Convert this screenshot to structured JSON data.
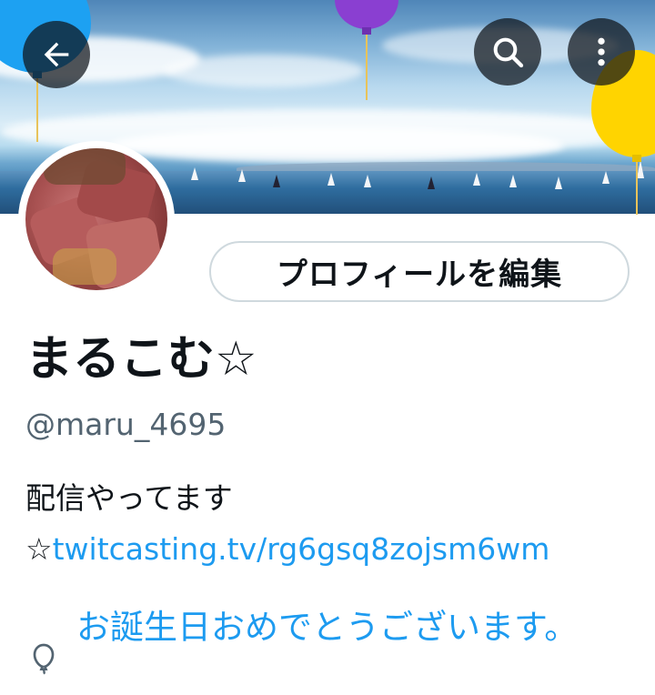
{
  "header": {
    "back_button": "back-arrow-icon",
    "search_button": "search-icon",
    "more_button": "more-vertical-icon"
  },
  "profile": {
    "edit_button_label": "プロフィールを編集",
    "display_name": "まるこむ☆",
    "handle": "@maru_4695",
    "bio_text": "配信やってます ☆",
    "bio_link": "twitcasting.tv/rg6gsq8zojsm6wm",
    "birthday_text": "お誕生日おめでとうございます。"
  },
  "colors": {
    "link": "#1d9bf0",
    "secondary_text": "#536471",
    "border": "#cfd9de",
    "balloon_blue": "#1da1f2",
    "balloon_purple": "#8a3fd1",
    "balloon_yellow": "#ffd400"
  }
}
